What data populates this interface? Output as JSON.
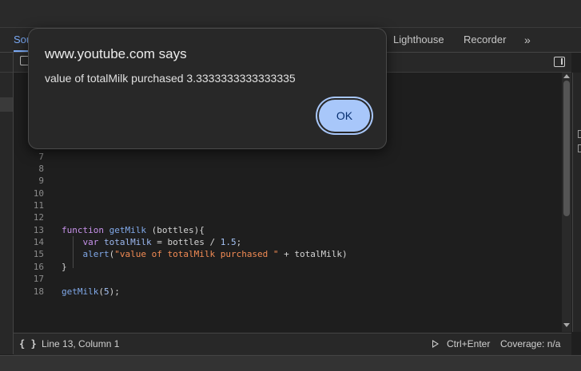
{
  "devtools": {
    "tabs": [
      {
        "label": "Sources",
        "visible_label": "Sou",
        "active": true
      },
      {
        "label": "Lighthouse",
        "active": false
      },
      {
        "label": "Recorder",
        "active": false
      }
    ],
    "more_tabs": "»"
  },
  "editor": {
    "lines": [
      {
        "num": "7",
        "code": ""
      },
      {
        "num": "8",
        "code": ""
      },
      {
        "num": "9",
        "code": ""
      },
      {
        "num": "10",
        "code": ""
      },
      {
        "num": "11",
        "code": ""
      },
      {
        "num": "12",
        "code": ""
      },
      {
        "num": "13",
        "code": "function getMilk (bottles){"
      },
      {
        "num": "14",
        "code": "    var totalMilk = bottles / 1.5;"
      },
      {
        "num": "15",
        "code": "    alert(\"value of totalMilk purchased \" + totalMilk)"
      },
      {
        "num": "16",
        "code": "}"
      },
      {
        "num": "17",
        "code": ""
      },
      {
        "num": "18",
        "code": "getMilk(5);"
      }
    ]
  },
  "status": {
    "braces": "{ }",
    "position": "Line 13, Column 1",
    "shortcut": "Ctrl+Enter",
    "coverage": "Coverage: n/a"
  },
  "dialog": {
    "title": "www.youtube.com says",
    "message": "value of totalMilk purchased 3.3333333333333335",
    "ok_label": "OK"
  },
  "colors": {
    "accent": "#7cacf8",
    "ok_button": "#a8c7fa",
    "keyword": "#c792ea",
    "string": "#f28b54"
  }
}
